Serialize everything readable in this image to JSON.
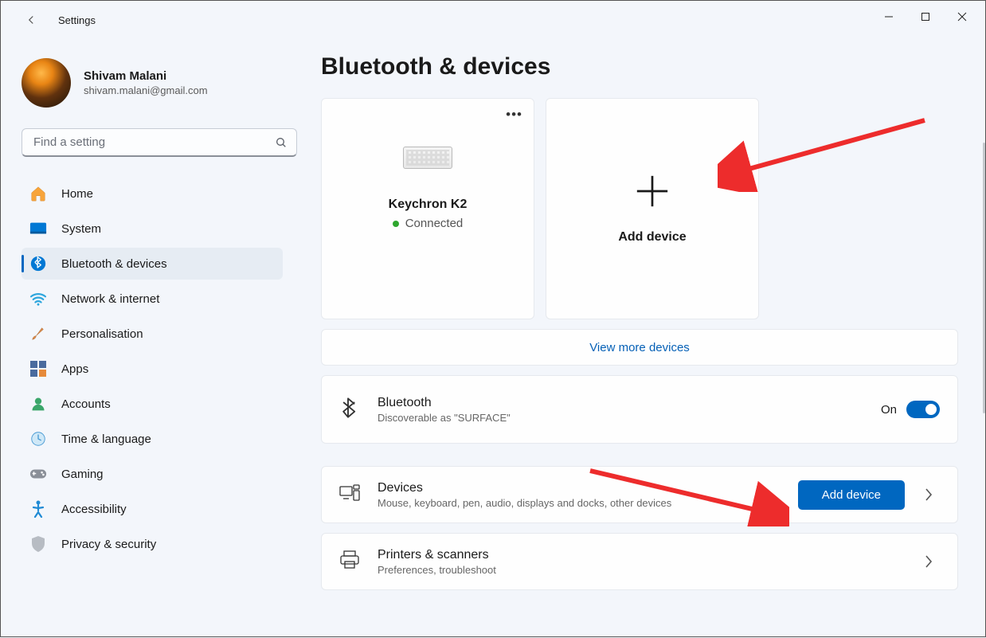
{
  "app": {
    "title": "Settings"
  },
  "profile": {
    "name": "Shivam Malani",
    "email": "shivam.malani@gmail.com"
  },
  "search": {
    "placeholder": "Find a setting"
  },
  "nav": {
    "home": "Home",
    "system": "System",
    "bluetooth": "Bluetooth & devices",
    "network": "Network & internet",
    "personalisation": "Personalisation",
    "apps": "Apps",
    "accounts": "Accounts",
    "time": "Time & language",
    "gaming": "Gaming",
    "accessibility": "Accessibility",
    "privacy": "Privacy & security"
  },
  "page": {
    "title": "Bluetooth & devices"
  },
  "device_card": {
    "name": "Keychron K2",
    "status": "Connected"
  },
  "add_card": {
    "label": "Add device"
  },
  "view_more": "View more devices",
  "bluetooth_row": {
    "title": "Bluetooth",
    "subtitle": "Discoverable as \"SURFACE\"",
    "state": "On"
  },
  "devices_row": {
    "title": "Devices",
    "subtitle": "Mouse, keyboard, pen, audio, displays and docks, other devices",
    "button": "Add device"
  },
  "printers_row": {
    "title": "Printers & scanners",
    "subtitle": "Preferences, troubleshoot"
  }
}
